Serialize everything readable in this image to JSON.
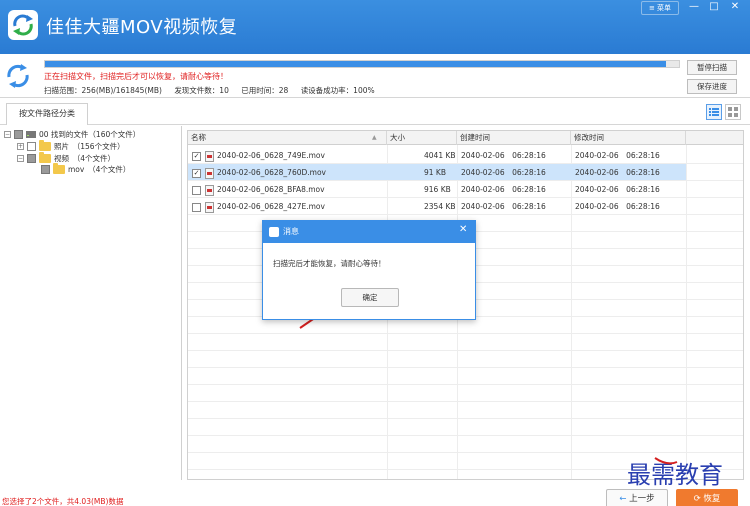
{
  "window": {
    "title": "佳佳大疆MOV视频恢复",
    "menu_label": "菜单",
    "minimize_glyph": "—",
    "maximize_glyph": "□",
    "close_glyph": "✕"
  },
  "scan": {
    "progress_fraction": 0.98,
    "message": "正在扫描文件，扫描完后才可以恢复，请耐心等待！",
    "stats": {
      "range": "扫描范围：256(MB)/161845(MB)",
      "found": "发现文件数：10",
      "elapsed": "已用时间：28",
      "read_rate": "读设备成功率：100%"
    },
    "pause_label": "暂停扫描",
    "save_label": "保存进度"
  },
  "tabs": {
    "active_label": "按文件路径分类"
  },
  "tree": {
    "root": "00 找到的文件（160个文件）",
    "photos": "照片　（156个文件）",
    "videos": "视频　（4个文件）",
    "mov": "mov　（4个文件）"
  },
  "table": {
    "columns": [
      "名称",
      "大小",
      "创建时间",
      "修改时间"
    ],
    "rows": [
      {
        "name": "2040-02-06_0628_749E.mov",
        "size": "4041 KB",
        "created": "2040-02-06　06:28:16",
        "modified": "2040-02-06　06:28:16",
        "checked": true
      },
      {
        "name": "2040-02-06_0628_760D.mov",
        "size": "91 KB",
        "created": "2040-02-06　06:28:16",
        "modified": "2040-02-06　06:28:16",
        "checked": true
      },
      {
        "name": "2040-02-06_0628_BFA8.mov",
        "size": "916 KB",
        "created": "2040-02-06　06:28:16",
        "modified": "2040-02-06　06:28:16",
        "checked": false
      },
      {
        "name": "2040-02-06_0628_427E.mov",
        "size": "2354 KB",
        "created": "2040-02-06　06:28:16",
        "modified": "2040-02-06　06:28:16",
        "checked": false
      }
    ]
  },
  "dialog": {
    "title": "消息",
    "message": "扫描完后才能恢复，请耐心等待！",
    "ok_label": "确定",
    "close_glyph": "✕"
  },
  "footer": {
    "selection_message": "您选择了2个文件，共4.03(MB)数据",
    "prev_label": "上一步",
    "recover_label": "恢复"
  },
  "watermark": {
    "text": "最需教育"
  },
  "colors": {
    "titlebar": "#3b8fe0",
    "accent": "#3a8ee6",
    "warning_text": "#e02020",
    "recover_button": "#f07a2e"
  }
}
